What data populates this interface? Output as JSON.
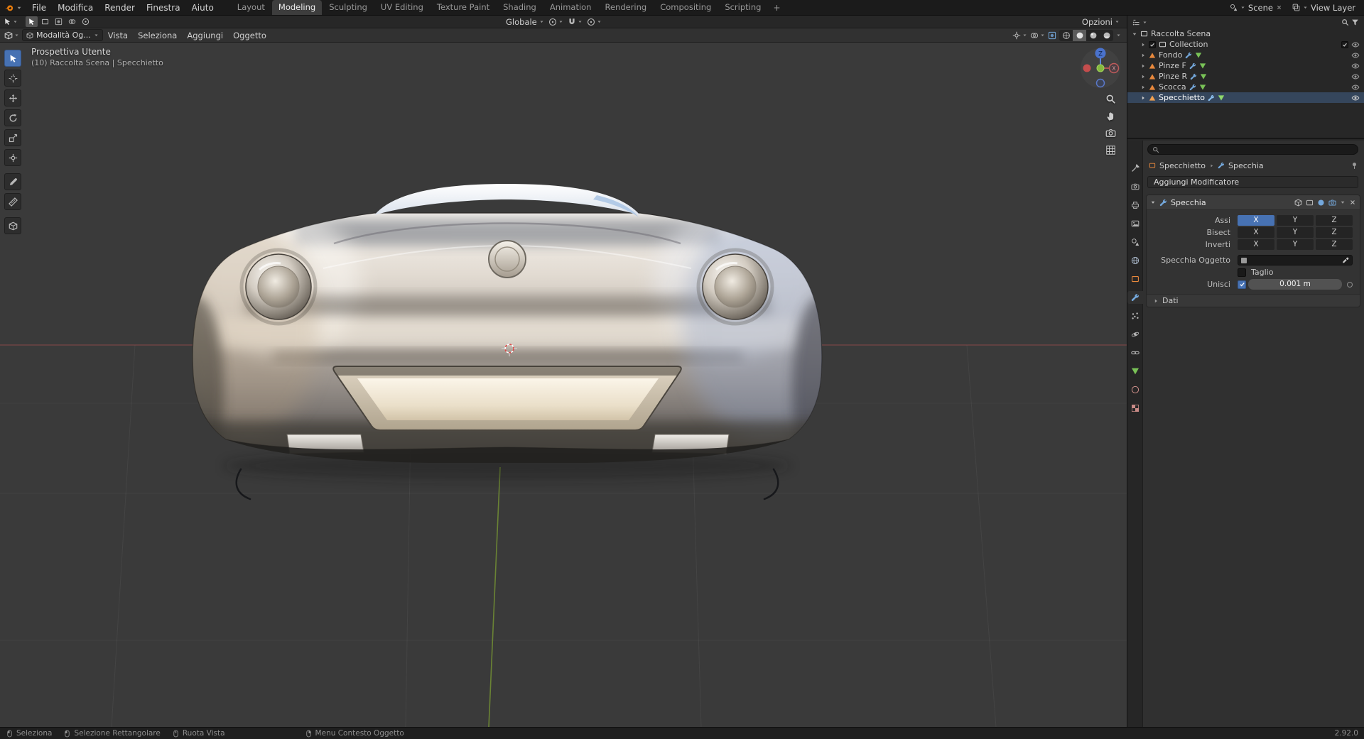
{
  "colors": {
    "accent": "#4772b3",
    "viewport_bg": "#3a3a3a",
    "axis_x_red": "#b35252",
    "axis_y_green": "#708c34",
    "object_orange": "#e8883c",
    "mesh_data_green": "#79c257",
    "modifier_blue": "#74a8dc"
  },
  "topbar": {
    "menus": [
      {
        "label": "File"
      },
      {
        "label": "Modifica"
      },
      {
        "label": "Render"
      },
      {
        "label": "Finestra"
      },
      {
        "label": "Aiuto"
      }
    ],
    "tabs": [
      {
        "label": "Layout"
      },
      {
        "label": "Modeling",
        "active": true
      },
      {
        "label": "Sculpting"
      },
      {
        "label": "UV Editing"
      },
      {
        "label": "Texture Paint"
      },
      {
        "label": "Shading"
      },
      {
        "label": "Animation"
      },
      {
        "label": "Rendering"
      },
      {
        "label": "Compositing"
      },
      {
        "label": "Scripting"
      }
    ],
    "add_workspace": "+",
    "scene_name": "Scene",
    "view_layer_name": "View Layer"
  },
  "tool_settings": {
    "orientation": "Globale",
    "options_label": "Opzioni"
  },
  "viewport_header": {
    "mode": "Modalità Og...",
    "menus": [
      {
        "label": "Vista"
      },
      {
        "label": "Seleziona"
      },
      {
        "label": "Aggiungi"
      },
      {
        "label": "Oggetto"
      }
    ]
  },
  "viewport": {
    "view_name": "Prospettiva Utente",
    "context_path": "(10) Raccolta Scena | Specchietto",
    "gizmo": {
      "z_label": "Z",
      "x_label": "X"
    }
  },
  "outliner": {
    "scene_collection": "Raccolta Scena",
    "items": [
      {
        "label": "Collection"
      },
      {
        "label": "Fondo"
      },
      {
        "label": "Pinze F"
      },
      {
        "label": "Pinze R"
      },
      {
        "label": "Scocca"
      },
      {
        "label": "Specchietto",
        "selected": true
      }
    ]
  },
  "properties": {
    "breadcrumb": {
      "object": "Specchietto",
      "modifier": "Specchia"
    },
    "add_modifier_label": "Aggiungi Modificatore",
    "modifier_panel": {
      "name": "Specchia",
      "axis_label": "Assi",
      "bisect_label": "Bisect",
      "flip_label": "Inverti",
      "axes": [
        "X",
        "Y",
        "Z"
      ],
      "active_axis": "X",
      "mirror_object_label": "Specchia Oggetto",
      "clipping_label": "Taglio",
      "clipping_checked": false,
      "merge_label": "Unisci",
      "merge_checked": true,
      "merge_value": "0.001 m",
      "data_section_label": "Dati"
    }
  },
  "statusbar": {
    "items": [
      {
        "label": "Seleziona"
      },
      {
        "label": "Selezione Rettangolare"
      },
      {
        "label": "Ruota Vista"
      },
      {
        "label": "Menu Contesto Oggetto"
      }
    ],
    "version": "2.92.0"
  },
  "icon_names": [
    "blender-logo-icon",
    "dropdown-caret-icon",
    "scene-icon",
    "view-layer-icon",
    "close-icon",
    "select-tool-icon",
    "cursor-tool-icon",
    "move-tool-icon",
    "rotate-tool-icon",
    "scale-tool-icon",
    "transform-tool-icon",
    "annotate-tool-icon",
    "measure-tool-icon",
    "add-cube-tool-icon",
    "pivot-point-icon",
    "snap-magnet-icon",
    "proportional-editing-icon",
    "editor-type-icon",
    "object-mode-icon",
    "gizmo-toggle-icon",
    "overlays-icon",
    "xray-toggle-icon",
    "shading-wireframe-icon",
    "shading-solid-icon",
    "shading-material-icon",
    "shading-rendered-icon",
    "navigation-gizmo",
    "zoom-icon",
    "pan-hand-icon",
    "camera-view-icon",
    "ortho-grid-icon",
    "collection-icon",
    "object-icon",
    "modifier-wrench-icon",
    "mesh-data-icon",
    "eye-icon",
    "checkbox-icon",
    "filter-funnel-icon",
    "search-icon",
    "pin-icon",
    "eyedropper-icon",
    "mouse-left-icon",
    "mouse-middle-icon",
    "mouse-right-icon"
  ]
}
